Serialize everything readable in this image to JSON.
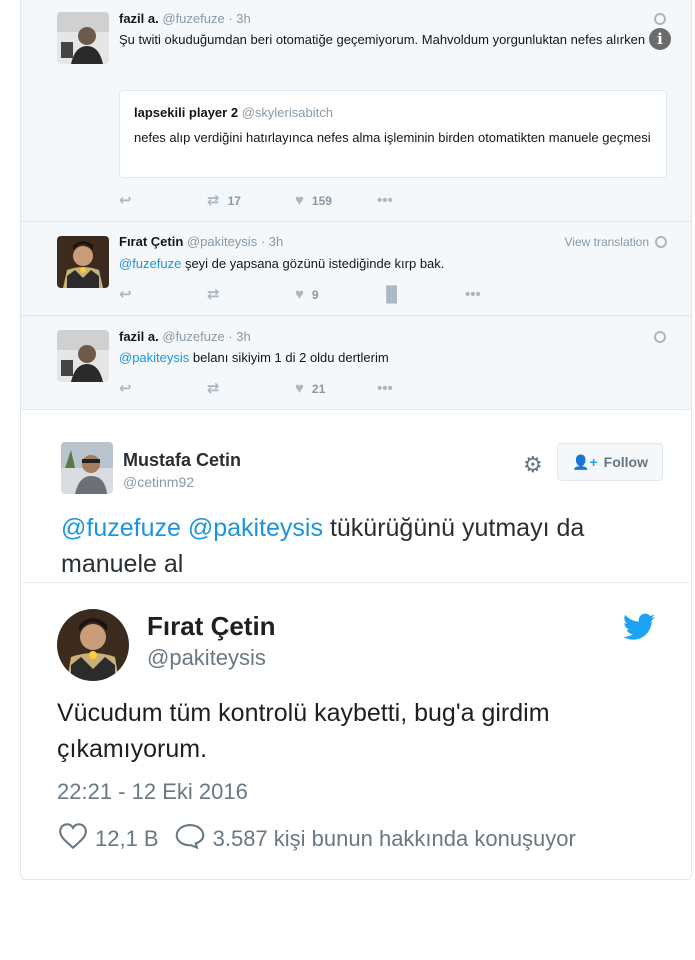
{
  "thread": {
    "tweet1": {
      "name": "fazil a.",
      "handle": "@fuzefuze",
      "time": "· 3h",
      "text": "Şu twiti okuduğumdan beri otomatiğe geçemiyorum. Mahvoldum yorgunluktan nefes alırken",
      "quote": {
        "name": "lapsekili player 2",
        "handle": "@skylerisabitch",
        "text": "nefes alıp verdiğini hatırlayınca nefes alma işleminin birden otomatikten manuele geçmesi"
      },
      "retweets": "17",
      "likes": "159"
    },
    "tweet2": {
      "name": "Fırat Çetin",
      "handle": "@pakiteysis",
      "time": "· 3h",
      "view_translation": "View translation",
      "mention": "@fuzefuze",
      "text": " şeyi de yapsana gözünü istediğinde kırp bak.",
      "likes": "9"
    },
    "tweet3": {
      "name": "fazil a.",
      "handle": "@fuzefuze",
      "time": "· 3h",
      "mention": "@pakiteysis",
      "text": " belanı sikiyim 1 di 2 oldu dertlerim",
      "likes": "21"
    }
  },
  "reply": {
    "name": "Mustafa Cetin",
    "handle": "@cetinm92",
    "follow_label": "Follow",
    "mention1": "@fuzefuze",
    "mention2": "@pakiteysis",
    "text": " tükürüğünü yutmayı da manuele al"
  },
  "embed": {
    "name": "Fırat Çetin",
    "handle": "@pakiteysis",
    "text": "Vücudum tüm kontrolü kaybetti, bug'a girdim çıkamıyorum.",
    "datetime": "22:21 - 12 Eki 2016",
    "likes": "12,1 B",
    "conversation": "3.587 kişi bunun hakkında konuşuyor"
  },
  "colors": {
    "link": "#1b95e0",
    "twitter_blue": "#1da1f2",
    "muted": "#8899a6"
  },
  "icons": [
    "reply-icon",
    "retweet-icon",
    "like-icon",
    "more-icon",
    "analytics-icon",
    "globe-icon",
    "info-icon",
    "gear-icon",
    "follow-icon",
    "twitter-bird-icon",
    "heart-icon",
    "comment-icon"
  ]
}
